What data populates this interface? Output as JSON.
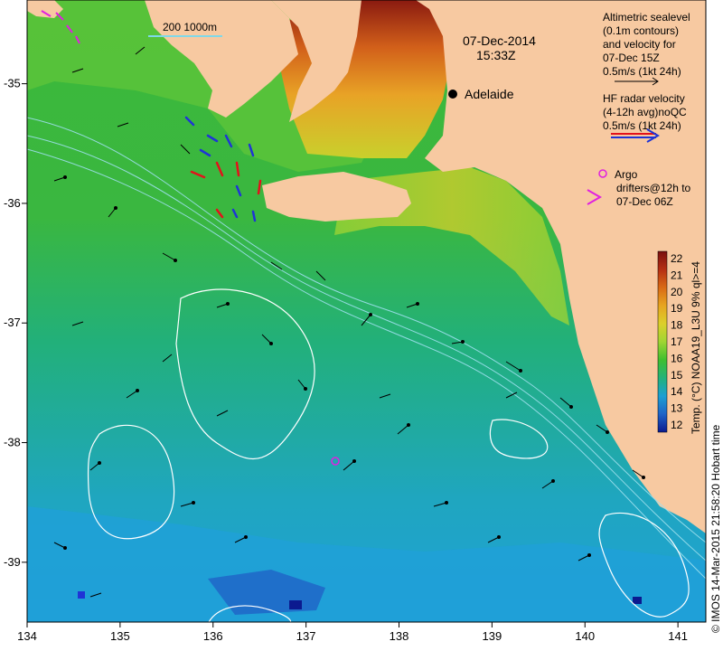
{
  "map": {
    "date": "07-Dec-2014",
    "time": "15:33Z",
    "place": "Adelaide",
    "scale_label": "200  1000m",
    "x_ticks": [
      "134",
      "135",
      "136",
      "137",
      "138",
      "139",
      "140",
      "141"
    ],
    "y_ticks": [
      "-35",
      "-36",
      "-37",
      "-38",
      "-39"
    ],
    "lon_range": [
      134,
      141.3
    ],
    "lat_range": [
      -39.5,
      -34.3
    ]
  },
  "legend": {
    "altimetric": [
      "Altimetric sealevel",
      "(0.1m contours)",
      "and velocity for",
      "07-Dec 15Z",
      "0.5m/s (1kt 24h)"
    ],
    "hf_radar": [
      "HF radar velocity",
      "(4-12h avg)noQC",
      "0.5m/s (1kt 24h)"
    ],
    "argo": [
      "Argo"
    ],
    "drifters": [
      "drifters@12h to",
      "07-Dec 06Z"
    ]
  },
  "colorbar": {
    "label": "Temp. (°C) NOAA19_L3U 9% ql>=4",
    "ticks": [
      "22",
      "21",
      "20",
      "19",
      "18",
      "17",
      "16",
      "15",
      "14",
      "13",
      "12"
    ],
    "colors": [
      "#7a1010",
      "#b52f12",
      "#d96a14",
      "#e7a520",
      "#dccf2a",
      "#9fd533",
      "#3fbf30",
      "#23b27a",
      "#1c9fd2",
      "#1f63c7",
      "#0b1a8f"
    ]
  },
  "credit": "© IMOS 14-Mar-2015 21:58:20 Hobart time",
  "colors": {
    "land": "#f7c9a1",
    "sea_green": "#34b33a",
    "sea_light_green": "#6ccd3a",
    "sea_cyan": "#1fb8b0",
    "sea_blue": "#22a6d8",
    "hf_red": "#e3121b",
    "hf_blue": "#1f34d6",
    "argo": "#e020e0"
  }
}
